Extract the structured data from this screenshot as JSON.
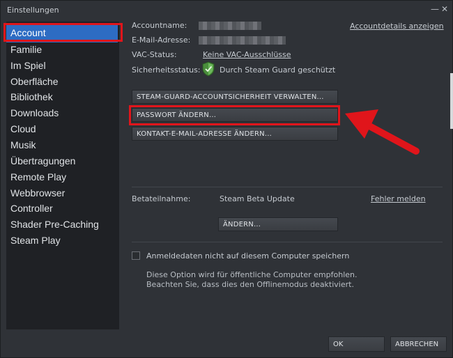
{
  "window": {
    "title": "Einstellungen",
    "minimize_glyph": "—",
    "close_glyph": "✕"
  },
  "sidebar": {
    "items": [
      {
        "label": "Account",
        "active": true
      },
      {
        "label": "Familie"
      },
      {
        "label": "Im Spiel"
      },
      {
        "label": "Oberfläche"
      },
      {
        "label": "Bibliothek"
      },
      {
        "label": "Downloads"
      },
      {
        "label": "Cloud"
      },
      {
        "label": "Musik"
      },
      {
        "label": "Übertragungen"
      },
      {
        "label": "Remote Play"
      },
      {
        "label": "Webbrowser"
      },
      {
        "label": "Controller"
      },
      {
        "label": "Shader Pre-Caching"
      },
      {
        "label": "Steam Play"
      }
    ]
  },
  "account": {
    "accountname_label": "Accountname:",
    "email_label": "E-Mail-Adresse:",
    "vac_label": "VAC-Status:",
    "vac_value": "Keine VAC-Ausschlüsse",
    "security_label": "Sicherheitsstatus:",
    "security_value": "Durch Steam Guard geschützt",
    "security_icon": "shield-check-icon",
    "details_link": "Accountdetails anzeigen"
  },
  "buttons": {
    "steam_guard": "STEAM-GUARD-ACCOUNTSICHERHEIT VERWALTEN...",
    "change_password": "PASSWORT ÄNDERN...",
    "change_email": "KONTAKT-E-MAIL-ADRESSE ÄNDERN..."
  },
  "beta": {
    "label": "Betateilnahme:",
    "value": "Steam Beta Update",
    "report_link": "Fehler melden",
    "change_button": "ÄNDERN..."
  },
  "credentials": {
    "checkbox_label": "Anmeldedaten nicht auf diesem Computer speichern",
    "checked": false,
    "note_line1": "Diese Option wird für öffentliche Computer empfohlen.",
    "note_line2": "Beachten Sie, dass dies den Offlinemodus deaktiviert."
  },
  "footer": {
    "ok": "OK",
    "cancel": "ABBRECHEN"
  },
  "colors": {
    "highlight": "#e0151b",
    "active_item": "#2d6cc3",
    "shield": "#5aa14a"
  }
}
